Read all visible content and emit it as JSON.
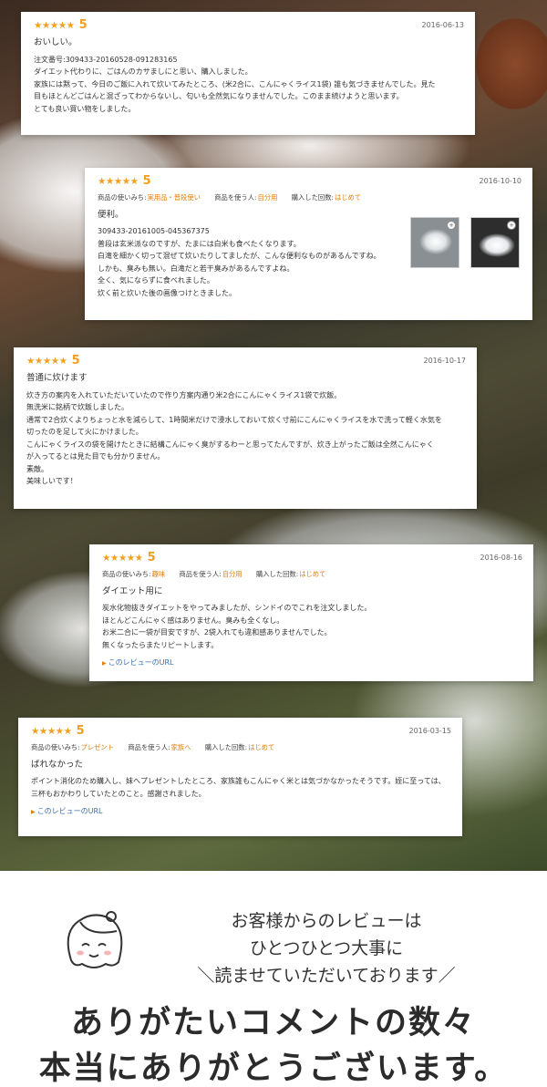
{
  "reviews": [
    {
      "stars": "★★★★★",
      "score": "5",
      "date": "2016-06-13",
      "title": "おいしい。",
      "lines": [
        "注文番号:309433-20160528-091283165",
        "ダイエット代わりに、ごはんのカサましにと思い、購入しました。",
        "家族には黙って、今日のご飯に入れて炊いてみたところ、(米2合に、こんにゃくライス1袋) 誰も気づきませんでした。見た",
        "目もほとんどごはんと混ざってわからないし、匂いも全然気になりませんでした。このまま続けようと思います。",
        "とても良い買い物をしました。"
      ]
    },
    {
      "stars": "★★★★★",
      "score": "5",
      "date": "2016-10-10",
      "meta": [
        {
          "key": "商品の使いみち:",
          "value": "実用品・普段使い"
        },
        {
          "key": "商品を使う人:",
          "value": "自分用"
        },
        {
          "key": "購入した回数:",
          "value": "はじめて"
        }
      ],
      "title": "便利。",
      "lines": [
        "309433-20161005-045367375",
        "普段は玄米派なのですが、たまには白米も食べたくなります。",
        "白滝を細かく切って混ぜて炊いたりしてましたが、こんな便利なものがあるんですね。",
        "しかも、臭みも無い。白滝だと若干臭みがあるんですよね。",
        "全く、気にならずに食べれました。",
        "炊く前と炊いた後の画像つけときました。"
      ]
    },
    {
      "stars": "★★★★★",
      "score": "5",
      "date": "2016-10-17",
      "title": "普通に炊けます",
      "lines": [
        "炊き方の案内を入れていただいていたので作り方案内通り米2合にこんにゃくライス1袋で炊飯。",
        "無洗米に銘柄で炊飯しました。",
        "通常で2合炊くよりちょっと水を減らして、1時間米だけで浸水しておいて炊く寸前にこんにゃくライスを水で洗って軽く水気を",
        "切ったのを足して火にかけました。",
        "こんにゃくライスの袋を開けたときに結構こんにゃく臭がするわーと思ってたんですが、炊き上がったご飯は全然こんにゃく",
        "が入ってるとは見た目でも分かりません。",
        "素敵。",
        "美味しいです！"
      ]
    },
    {
      "stars": "★★★★★",
      "score": "5",
      "date": "2016-08-16",
      "meta": [
        {
          "key": "商品の使いみち:",
          "value": "趣味"
        },
        {
          "key": "商品を使う人:",
          "value": "自分用"
        },
        {
          "key": "購入した回数:",
          "value": "はじめて"
        }
      ],
      "title": "ダイエット用に",
      "lines": [
        "炭水化物抜きダイエットをやってみましたが、シンドイのでこれを注文しました。",
        "ほとんどこんにゃく感はありません。臭みも全くなし。",
        "お米二合に一袋が目安ですが、2袋入れても違和感ありませんでした。",
        "無くなったらまたリピートします。"
      ],
      "link": "このレビューのURL"
    },
    {
      "stars": "★★★★★",
      "score": "5",
      "date": "2016-03-15",
      "meta": [
        {
          "key": "商品の使いみち:",
          "value": "プレゼント"
        },
        {
          "key": "商品を使う人:",
          "value": "家族へ"
        },
        {
          "key": "購入した回数:",
          "value": "はじめて"
        }
      ],
      "title": "ばれなかった",
      "lines": [
        "ポイント消化のため購入し、妹へプレゼントしたところ、家族誰もこんにゃく米とは気づかなかったそうです。姪に至っては、",
        "三杯もおかわりしていたとのこと。感謝されました。"
      ],
      "link": "このレビューのURL"
    }
  ],
  "message": {
    "line1": "お客様からのレビューは",
    "line2": "ひとつひとつ大事に",
    "line3": "＼読ませていただいております／"
  },
  "headline": {
    "line1": "ありがたいコメントの数々",
    "line2": "本当にありがとうございます。"
  }
}
